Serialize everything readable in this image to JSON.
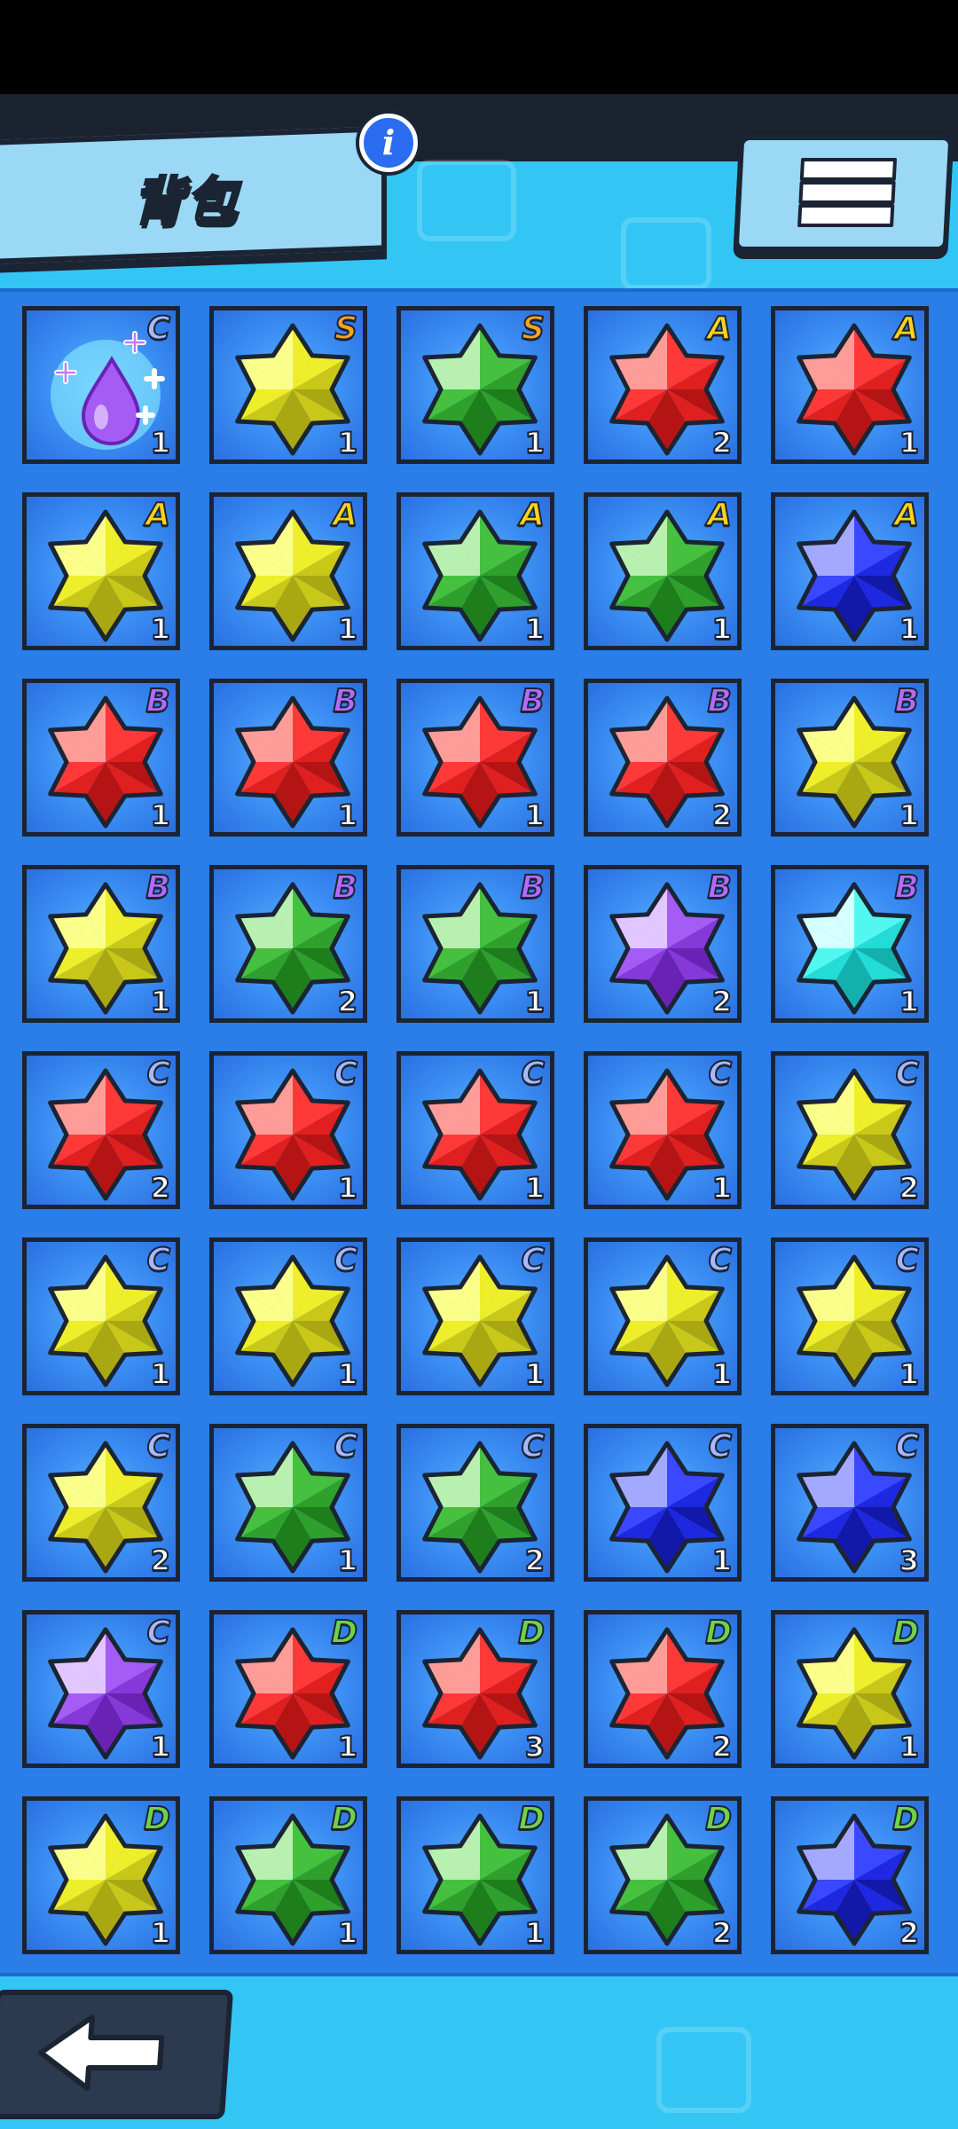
{
  "header": {
    "title": "背包",
    "info_icon": "info-icon",
    "menu_icon": "hamburger-menu-icon"
  },
  "footer": {
    "back_icon": "back-arrow-icon"
  },
  "colors": {
    "S": "#ffa21f",
    "A": "#ffd21a",
    "B": "#b36bff",
    "C": "#a8b8ff",
    "D": "#6fd34a"
  },
  "gem_colors": {
    "yellow": [
      "#fbff8a",
      "#eeee2a",
      "#c9c818",
      "#a9a812"
    ],
    "green": [
      "#b8f0b0",
      "#45c13f",
      "#2fa02b",
      "#1e7e1c"
    ],
    "red": [
      "#ff9c98",
      "#ff3838",
      "#e01f1f",
      "#b51414"
    ],
    "blue": [
      "#a3a9ff",
      "#3a48ff",
      "#1e28e0",
      "#1218a8"
    ],
    "purple": [
      "#e2c6ff",
      "#a45cf5",
      "#8638d8",
      "#6a22b5"
    ],
    "cyan": [
      "#d6ffff",
      "#52f8f0",
      "#23dcd6",
      "#13b0ad"
    ]
  },
  "items": [
    {
      "kind": "drop",
      "color": "purple",
      "grade": "C",
      "qty": "1"
    },
    {
      "kind": "gem",
      "color": "yellow",
      "grade": "S",
      "qty": "1"
    },
    {
      "kind": "gem",
      "color": "green",
      "grade": "S",
      "qty": "1"
    },
    {
      "kind": "gem",
      "color": "red",
      "grade": "A",
      "qty": "2"
    },
    {
      "kind": "gem",
      "color": "red",
      "grade": "A",
      "qty": "1"
    },
    {
      "kind": "gem",
      "color": "yellow",
      "grade": "A",
      "qty": "1"
    },
    {
      "kind": "gem",
      "color": "yellow",
      "grade": "A",
      "qty": "1"
    },
    {
      "kind": "gem",
      "color": "green",
      "grade": "A",
      "qty": "1"
    },
    {
      "kind": "gem",
      "color": "green",
      "grade": "A",
      "qty": "1"
    },
    {
      "kind": "gem",
      "color": "blue",
      "grade": "A",
      "qty": "1"
    },
    {
      "kind": "gem",
      "color": "red",
      "grade": "B",
      "qty": "1"
    },
    {
      "kind": "gem",
      "color": "red",
      "grade": "B",
      "qty": "1"
    },
    {
      "kind": "gem",
      "color": "red",
      "grade": "B",
      "qty": "1"
    },
    {
      "kind": "gem",
      "color": "red",
      "grade": "B",
      "qty": "2"
    },
    {
      "kind": "gem",
      "color": "yellow",
      "grade": "B",
      "qty": "1"
    },
    {
      "kind": "gem",
      "color": "yellow",
      "grade": "B",
      "qty": "1"
    },
    {
      "kind": "gem",
      "color": "green",
      "grade": "B",
      "qty": "2"
    },
    {
      "kind": "gem",
      "color": "green",
      "grade": "B",
      "qty": "1"
    },
    {
      "kind": "gem",
      "color": "purple",
      "grade": "B",
      "qty": "2"
    },
    {
      "kind": "gem",
      "color": "cyan",
      "grade": "B",
      "qty": "1"
    },
    {
      "kind": "gem",
      "color": "red",
      "grade": "C",
      "qty": "2"
    },
    {
      "kind": "gem",
      "color": "red",
      "grade": "C",
      "qty": "1"
    },
    {
      "kind": "gem",
      "color": "red",
      "grade": "C",
      "qty": "1"
    },
    {
      "kind": "gem",
      "color": "red",
      "grade": "C",
      "qty": "1"
    },
    {
      "kind": "gem",
      "color": "yellow",
      "grade": "C",
      "qty": "2"
    },
    {
      "kind": "gem",
      "color": "yellow",
      "grade": "C",
      "qty": "1"
    },
    {
      "kind": "gem",
      "color": "yellow",
      "grade": "C",
      "qty": "1"
    },
    {
      "kind": "gem",
      "color": "yellow",
      "grade": "C",
      "qty": "1"
    },
    {
      "kind": "gem",
      "color": "yellow",
      "grade": "C",
      "qty": "1"
    },
    {
      "kind": "gem",
      "color": "yellow",
      "grade": "C",
      "qty": "1"
    },
    {
      "kind": "gem",
      "color": "yellow",
      "grade": "C",
      "qty": "2"
    },
    {
      "kind": "gem",
      "color": "green",
      "grade": "C",
      "qty": "1"
    },
    {
      "kind": "gem",
      "color": "green",
      "grade": "C",
      "qty": "2"
    },
    {
      "kind": "gem",
      "color": "blue",
      "grade": "C",
      "qty": "1"
    },
    {
      "kind": "gem",
      "color": "blue",
      "grade": "C",
      "qty": "3"
    },
    {
      "kind": "gem",
      "color": "purple",
      "grade": "C",
      "qty": "1"
    },
    {
      "kind": "gem",
      "color": "red",
      "grade": "D",
      "qty": "1"
    },
    {
      "kind": "gem",
      "color": "red",
      "grade": "D",
      "qty": "3"
    },
    {
      "kind": "gem",
      "color": "red",
      "grade": "D",
      "qty": "2"
    },
    {
      "kind": "gem",
      "color": "yellow",
      "grade": "D",
      "qty": "1"
    },
    {
      "kind": "gem",
      "color": "yellow",
      "grade": "D",
      "qty": "1"
    },
    {
      "kind": "gem",
      "color": "green",
      "grade": "D",
      "qty": "1"
    },
    {
      "kind": "gem",
      "color": "green",
      "grade": "D",
      "qty": "1"
    },
    {
      "kind": "gem",
      "color": "green",
      "grade": "D",
      "qty": "2"
    },
    {
      "kind": "gem",
      "color": "blue",
      "grade": "D",
      "qty": "2"
    }
  ]
}
